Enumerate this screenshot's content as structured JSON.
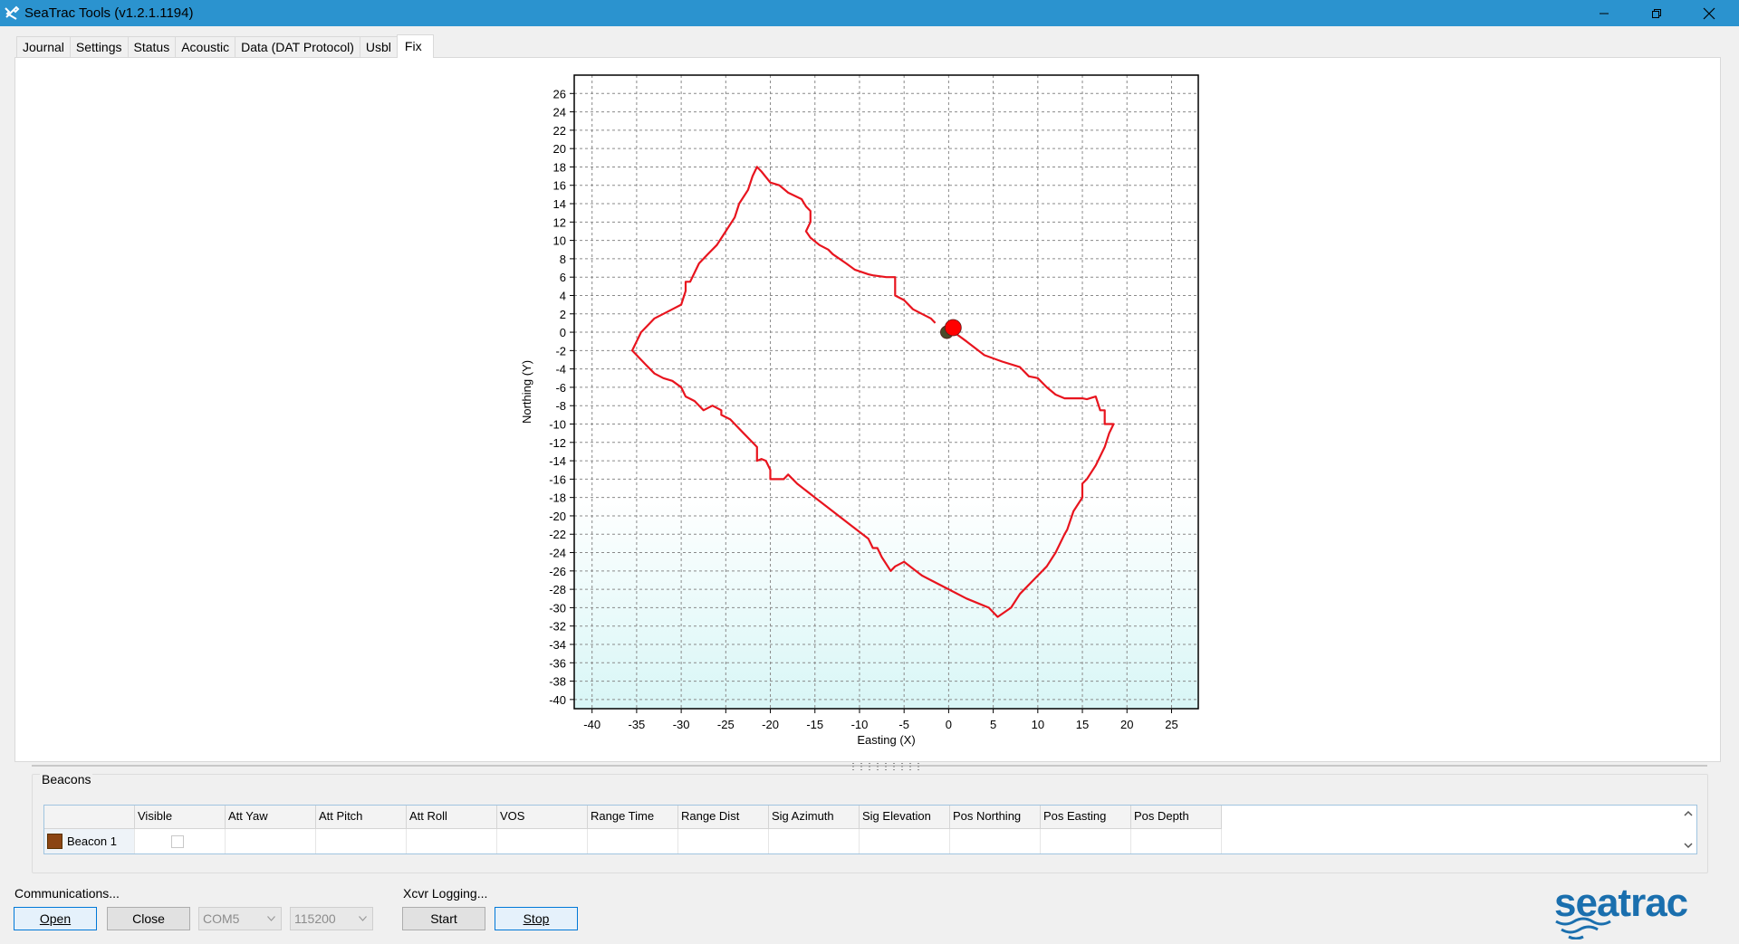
{
  "window": {
    "title": "SeaTrac Tools (v1.2.1.1194)",
    "icon": "tools-icon"
  },
  "tabs": [
    {
      "label": "Journal"
    },
    {
      "label": "Settings"
    },
    {
      "label": "Status"
    },
    {
      "label": "Acoustic"
    },
    {
      "label": "Data (DAT Protocol)"
    },
    {
      "label": "Usbl"
    },
    {
      "label": "Fix",
      "active": true
    }
  ],
  "chart_data": {
    "type": "line",
    "xlabel": "Easting (X)",
    "ylabel": "Northing (Y)",
    "xlim": [
      -42,
      28
    ],
    "ylim": [
      -41,
      28
    ],
    "xticks": [
      -40,
      -35,
      -30,
      -25,
      -20,
      -15,
      -10,
      -5,
      0,
      5,
      10,
      15,
      20,
      25
    ],
    "yticks": [
      26,
      24,
      22,
      20,
      18,
      16,
      14,
      12,
      10,
      8,
      6,
      4,
      2,
      0,
      -2,
      -4,
      -6,
      -8,
      -10,
      -12,
      -14,
      -16,
      -18,
      -20,
      -22,
      -24,
      -26,
      -28,
      -30,
      -32,
      -34,
      -36,
      -38,
      -40
    ],
    "grid": true,
    "series": [
      {
        "color": "#e8141e",
        "points": [
          [
            0.3,
            0.2
          ],
          [
            2,
            -1
          ],
          [
            4,
            -2.5
          ],
          [
            6,
            -3.2
          ],
          [
            8,
            -3.8
          ],
          [
            9,
            -4.8
          ],
          [
            10,
            -5
          ],
          [
            11,
            -6
          ],
          [
            12,
            -6.8
          ],
          [
            13,
            -7.2
          ],
          [
            15,
            -7.2
          ],
          [
            15.5,
            -7.3
          ],
          [
            16.5,
            -7
          ],
          [
            17,
            -8.5
          ],
          [
            17.5,
            -8.5
          ],
          [
            17.5,
            -10
          ],
          [
            18.5,
            -10
          ],
          [
            18,
            -11
          ],
          [
            17.5,
            -12.5
          ],
          [
            16.5,
            -14.5
          ],
          [
            15.5,
            -16
          ],
          [
            15,
            -16.5
          ],
          [
            15,
            -18
          ],
          [
            14,
            -19.5
          ],
          [
            13.3,
            -21.5
          ],
          [
            13,
            -22
          ],
          [
            12,
            -24
          ],
          [
            11,
            -25.5
          ],
          [
            9.5,
            -27
          ],
          [
            8,
            -28.5
          ],
          [
            7,
            -30
          ],
          [
            5.5,
            -31
          ],
          [
            4.5,
            -30
          ],
          [
            2,
            -29
          ],
          [
            0,
            -28
          ],
          [
            -2,
            -27
          ],
          [
            -3,
            -26.5
          ],
          [
            -5,
            -25
          ],
          [
            -6,
            -25.5
          ],
          [
            -6.5,
            -26
          ],
          [
            -7.5,
            -24.5
          ],
          [
            -8,
            -23.5
          ],
          [
            -8.5,
            -23.5
          ],
          [
            -9,
            -22.5
          ],
          [
            -11,
            -21
          ],
          [
            -13,
            -19.5
          ],
          [
            -15,
            -18
          ],
          [
            -17,
            -16.5
          ],
          [
            -18,
            -15.5
          ],
          [
            -18.5,
            -16
          ],
          [
            -20,
            -16
          ],
          [
            -20,
            -15
          ],
          [
            -20.5,
            -14
          ],
          [
            -21,
            -13.8
          ],
          [
            -21.5,
            -14
          ],
          [
            -21.5,
            -12.5
          ],
          [
            -23,
            -11
          ],
          [
            -24,
            -10
          ],
          [
            -24.5,
            -9.5
          ],
          [
            -25.5,
            -9
          ],
          [
            -25.5,
            -8.5
          ],
          [
            -26.5,
            -8
          ],
          [
            -27.5,
            -8.5
          ],
          [
            -28.5,
            -7.5
          ],
          [
            -29.5,
            -7
          ],
          [
            -30,
            -6
          ],
          [
            -31,
            -5.3
          ],
          [
            -32,
            -5
          ],
          [
            -33,
            -4.5
          ],
          [
            -34,
            -3.5
          ],
          [
            -35,
            -2.5
          ],
          [
            -35.5,
            -2
          ],
          [
            -35,
            -1
          ],
          [
            -34.5,
            0
          ],
          [
            -33.5,
            1
          ],
          [
            -33,
            1.5
          ],
          [
            -32,
            2
          ],
          [
            -31,
            2.5
          ],
          [
            -30,
            3
          ],
          [
            -29.5,
            4.5
          ],
          [
            -29.5,
            5.5
          ],
          [
            -29,
            5.5
          ],
          [
            -28.5,
            6.5
          ],
          [
            -28,
            7.5
          ],
          [
            -27,
            8.5
          ],
          [
            -26,
            9.5
          ],
          [
            -25,
            11
          ],
          [
            -24,
            12.5
          ],
          [
            -23.5,
            14
          ],
          [
            -22.5,
            15.5
          ],
          [
            -22,
            17
          ],
          [
            -21.5,
            18
          ],
          [
            -21,
            17.5
          ],
          [
            -20,
            16.3
          ],
          [
            -19,
            16
          ],
          [
            -18,
            15.2
          ],
          [
            -16.5,
            14.5
          ],
          [
            -16,
            13.7
          ],
          [
            -15.5,
            13.2
          ],
          [
            -15.5,
            12
          ],
          [
            -16,
            11
          ],
          [
            -15.5,
            10.3
          ],
          [
            -14.5,
            9.5
          ],
          [
            -13.5,
            9
          ],
          [
            -13,
            8.5
          ],
          [
            -11.5,
            7.5
          ],
          [
            -10.5,
            6.8
          ],
          [
            -9,
            6.3
          ],
          [
            -8.5,
            6.2
          ],
          [
            -7,
            6
          ],
          [
            -6,
            6
          ],
          [
            -6,
            4
          ],
          [
            -5,
            3.5
          ],
          [
            -4,
            2.5
          ],
          [
            -3,
            2
          ],
          [
            -2,
            1.5
          ],
          [
            -1.5,
            1
          ]
        ]
      }
    ],
    "markers": [
      {
        "x": -0.2,
        "y": 0,
        "color": "#4a4a2a",
        "name": "origin"
      },
      {
        "x": 0.5,
        "y": 0.5,
        "color": "#ff0000",
        "name": "beacon-position"
      }
    ],
    "lower_shading_below_y": -18
  },
  "beacons": {
    "group_title": "Beacons",
    "columns": [
      {
        "label": ""
      },
      {
        "label": "Visible"
      },
      {
        "label": "Att Yaw"
      },
      {
        "label": "Att Pitch"
      },
      {
        "label": "Att Roll"
      },
      {
        "label": "VOS"
      },
      {
        "label": "Range Time"
      },
      {
        "label": "Range Dist"
      },
      {
        "label": "Sig Azimuth"
      },
      {
        "label": "Sig Elevation"
      },
      {
        "label": "Pos Northing"
      },
      {
        "label": "Pos Easting"
      },
      {
        "label": "Pos Depth"
      }
    ],
    "rows": [
      {
        "name": "Beacon 1",
        "swatch_color": "#8b4513",
        "visible": false
      }
    ]
  },
  "communications": {
    "group_title": "Communications...",
    "open_label": "Open",
    "close_label": "Close",
    "port_value": "COM5",
    "baud_value": "115200"
  },
  "logging": {
    "group_title": "Xcvr Logging...",
    "start_label": "Start",
    "stop_label": "Stop"
  },
  "logo": {
    "text": "seatrac",
    "color": "#1a6fae"
  }
}
